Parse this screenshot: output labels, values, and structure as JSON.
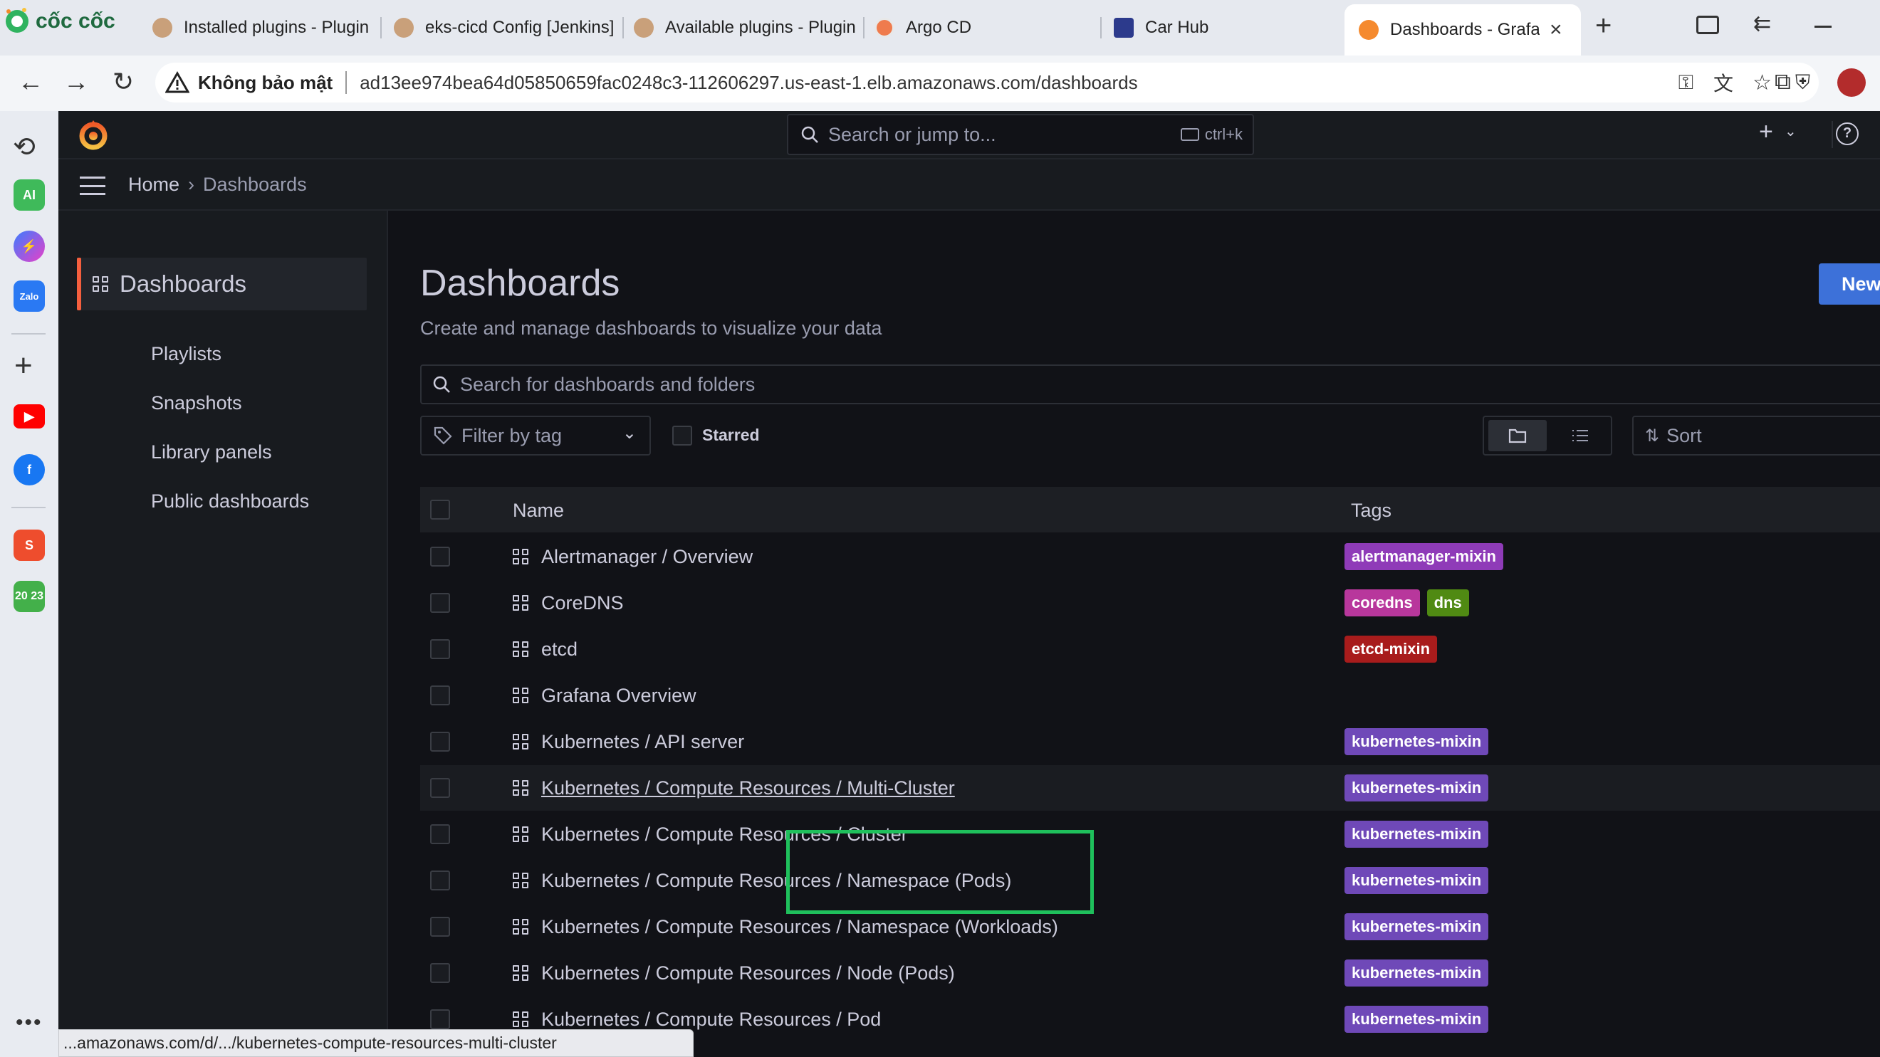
{
  "browser": {
    "brand": "cốc cốc",
    "tabs": [
      {
        "label": "Installed plugins - Plugin"
      },
      {
        "label": "eks-cicd Config [Jenkins]"
      },
      {
        "label": "Available plugins - Plugin"
      },
      {
        "label": "Argo CD"
      },
      {
        "label": "Car Hub"
      },
      {
        "label": "Dashboards - Grafan"
      }
    ],
    "security_label": "Không bảo mật",
    "url": "ad13ee974bea64d05850659fac0248c3-112606297.us-east-1.elb.amazonaws.com/dashboards",
    "status_url": "...amazonaws.com/d/.../kubernetes-compute-resources-multi-cluster",
    "sidebar_labels": {
      "ai": "AI",
      "zalo": "Zalo",
      "calendar": "20 23"
    }
  },
  "grafana": {
    "search_placeholder": "Search or jump to...",
    "search_shortcut": "ctrl+k",
    "breadcrumb": {
      "home": "Home",
      "sep": "›",
      "current": "Dashboards"
    },
    "nav": {
      "active": "Dashboards",
      "items": [
        "Playlists",
        "Snapshots",
        "Library panels",
        "Public dashboards"
      ]
    },
    "page": {
      "title": "Dashboards",
      "subtitle": "Create and manage dashboards to visualize your data",
      "new_button": "New",
      "search_placeholder": "Search for dashboards and folders",
      "filter_tag_placeholder": "Filter by tag",
      "starred_label": "Starred",
      "sort_label": "Sort"
    },
    "table": {
      "headers": {
        "name": "Name",
        "tags": "Tags"
      },
      "rows": [
        {
          "name": "Alertmanager / Overview",
          "tags": [
            {
              "label": "alertmanager-mixin",
              "color": "#8f3bb8"
            }
          ]
        },
        {
          "name": "CoreDNS",
          "tags": [
            {
              "label": "coredns",
              "color": "#b8379c"
            },
            {
              "label": "dns",
              "color": "#508a13"
            }
          ]
        },
        {
          "name": "etcd",
          "tags": [
            {
              "label": "etcd-mixin",
              "color": "#a81c1c"
            }
          ]
        },
        {
          "name": "Grafana Overview",
          "tags": []
        },
        {
          "name": "Kubernetes / API server",
          "tags": [
            {
              "label": "kubernetes-mixin",
              "color": "#6f49b8"
            }
          ]
        },
        {
          "name": "Kubernetes / Compute Resources / Multi-Cluster",
          "tags": [
            {
              "label": "kubernetes-mixin",
              "color": "#6f49b8"
            }
          ]
        },
        {
          "name": "Kubernetes / Compute Resources / Cluster",
          "tags": [
            {
              "label": "kubernetes-mixin",
              "color": "#6f49b8"
            }
          ]
        },
        {
          "name": "Kubernetes / Compute Resources / Namespace (Pods)",
          "tags": [
            {
              "label": "kubernetes-mixin",
              "color": "#6f49b8"
            }
          ]
        },
        {
          "name": "Kubernetes / Compute Resources / Namespace (Workloads)",
          "tags": [
            {
              "label": "kubernetes-mixin",
              "color": "#6f49b8"
            }
          ]
        },
        {
          "name": "Kubernetes / Compute Resources / Node (Pods)",
          "tags": [
            {
              "label": "kubernetes-mixin",
              "color": "#6f49b8"
            }
          ]
        },
        {
          "name": "Kubernetes / Compute Resources / Pod",
          "tags": [
            {
              "label": "kubernetes-mixin",
              "color": "#6f49b8"
            }
          ]
        }
      ]
    },
    "hovered_row": "Kubernetes / Compute Resources / Multi-Cluster"
  },
  "colors": {
    "accent": "#f55f3e",
    "primary": "#3d71d9",
    "highlight_box": "#1fc05c"
  }
}
